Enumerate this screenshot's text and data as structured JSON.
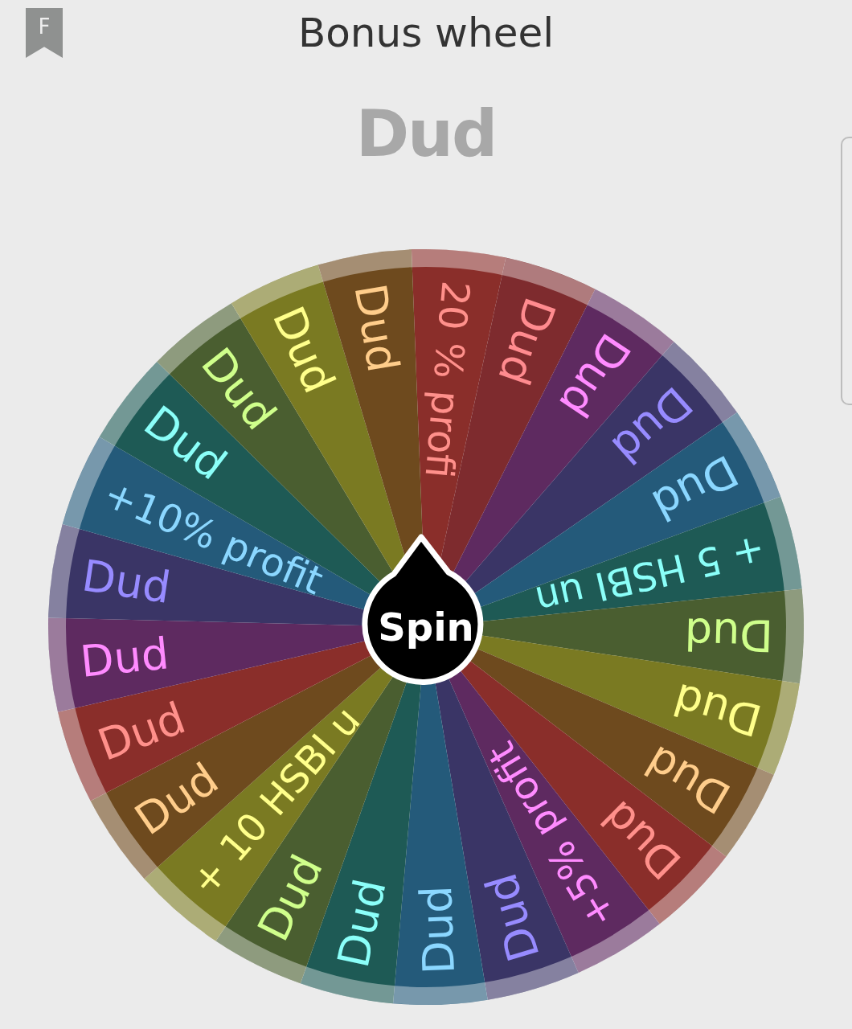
{
  "header": {
    "badge": "F",
    "title": "Bonus wheel"
  },
  "result": "Dud",
  "wheel": {
    "segments": [
      {
        "label": "20 % profi",
        "color": "#8a2e2a"
      },
      {
        "label": "Dud",
        "color": "#7e2b2e"
      },
      {
        "label": "Dud",
        "color": "#5e2a60"
      },
      {
        "label": "Dud",
        "color": "#3a3566"
      },
      {
        "label": "Dud",
        "color": "#245a7a"
      },
      {
        "label": "+ 5 HSBI un",
        "color": "#1e5a55"
      },
      {
        "label": "Dud",
        "color": "#4a5e30"
      },
      {
        "label": "Dud",
        "color": "#7a7a22"
      },
      {
        "label": "Dud",
        "color": "#6e4a1e"
      },
      {
        "label": "Dud",
        "color": "#8a2e2a"
      },
      {
        "label": "+5% profit",
        "color": "#5e2a60"
      },
      {
        "label": "Dud",
        "color": "#3a3566"
      },
      {
        "label": "Dud",
        "color": "#245a7a"
      },
      {
        "label": "Dud",
        "color": "#1e5a55"
      },
      {
        "label": "Dud",
        "color": "#4a5e30"
      },
      {
        "label": "+ 10 HSBI u",
        "color": "#7a7a22"
      },
      {
        "label": "Dud",
        "color": "#6e4a1e"
      },
      {
        "label": "Dud",
        "color": "#8a2e2a"
      },
      {
        "label": "Dud",
        "color": "#5e2a60"
      },
      {
        "label": "Dud",
        "color": "#3a3566"
      },
      {
        "label": "+10% profit",
        "color": "#245a7a"
      },
      {
        "label": "Dud",
        "color": "#1e5a55"
      },
      {
        "label": "Dud",
        "color": "#4a5e30"
      },
      {
        "label": "Dud",
        "color": "#7a7a22"
      },
      {
        "label": "Dud",
        "color": "#6e4a1e"
      }
    ]
  },
  "spin_button": {
    "label": "Spin"
  }
}
